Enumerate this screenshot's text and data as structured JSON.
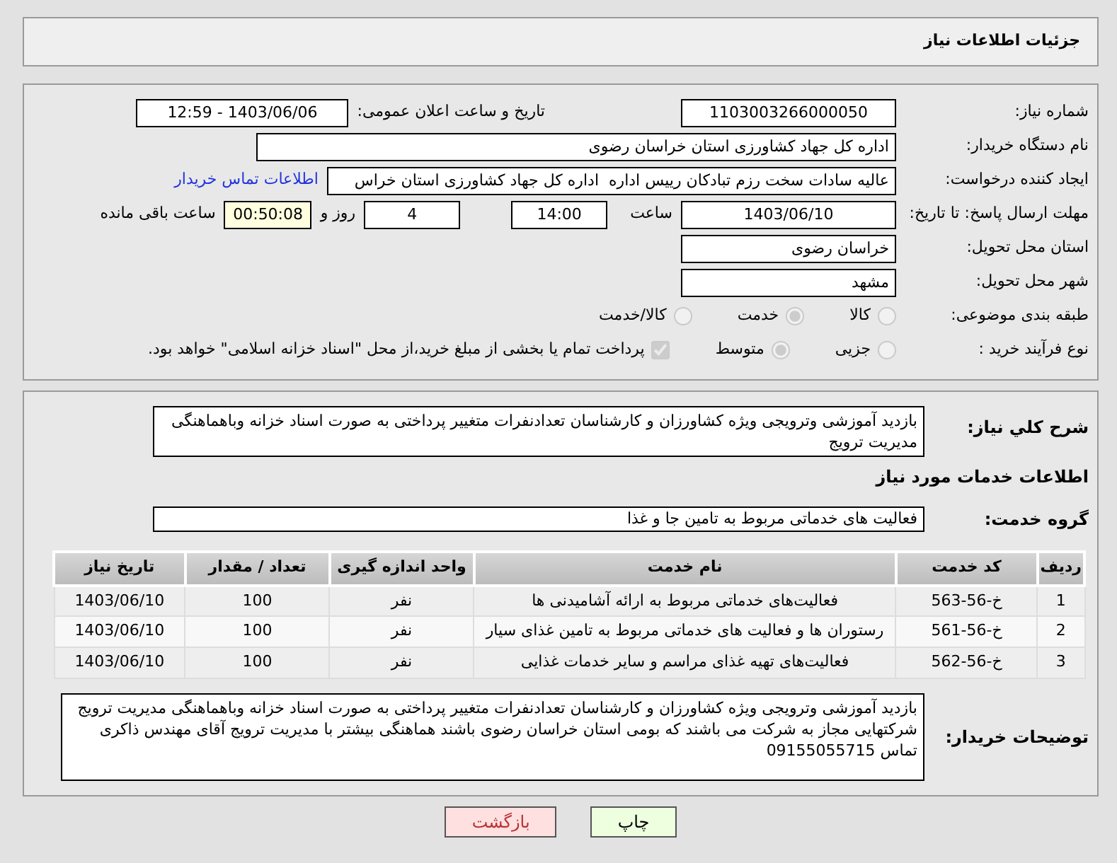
{
  "header": {
    "title": "جزئیات اطلاعات نیاز"
  },
  "need_number": {
    "label": "شماره نیاز:",
    "value": "1103003266000050"
  },
  "announce": {
    "label": "تاریخ و ساعت اعلان عمومی:",
    "value": "1403/06/06 - 12:59"
  },
  "buyer_org": {
    "label": "نام دستگاه خریدار:",
    "value": "اداره کل جهاد کشاورزی استان خراسان رضوی"
  },
  "requester": {
    "label": "ایجاد کننده درخواست:",
    "value": "عالیه سادات سخت رزم تبادکان رییس اداره  اداره کل جهاد کشاورزی استان خراس",
    "link": "اطلاعات تماس خریدار"
  },
  "deadline": {
    "label": "مهلت ارسال پاسخ: تا تاریخ:",
    "date": "1403/06/10",
    "time_label": "ساعت",
    "time": "14:00",
    "days": "4",
    "days_label": "روز و",
    "remaining": "00:50:08",
    "remaining_label": "ساعت باقی مانده"
  },
  "province": {
    "label": "استان محل تحویل:",
    "value": "خراسان رضوی"
  },
  "city": {
    "label": "شهر محل تحویل:",
    "value": "مشهد"
  },
  "category": {
    "label": "طبقه بندی موضوعی:",
    "options": [
      {
        "label": "کالا",
        "selected": false
      },
      {
        "label": "خدمت",
        "selected": true
      },
      {
        "label": "کالا/خدمت",
        "selected": false
      }
    ]
  },
  "process": {
    "label": "نوع فرآیند خرید :",
    "options": [
      {
        "label": "جزیی",
        "selected": false
      },
      {
        "label": "متوسط",
        "selected": true
      }
    ],
    "payment": {
      "label": "پرداخت تمام یا بخشی از مبلغ خرید،از محل \"اسناد خزانه اسلامی\" خواهد بود.",
      "checked": true
    }
  },
  "description": {
    "label": "شرح کلي نياز:",
    "value": "بازدید آموزشی وترویجی ویژه کشاورزان و کارشناسان تعدادنفرات متغییر پرداختی به صورت اسناد خزانه وباهماهنگی مدیریت ترویج"
  },
  "services_title": "اطلاعات خدمات مورد نیاز",
  "service_group": {
    "label": "گروه خدمت:",
    "value": "فعالیت های خدماتی مربوط به تامین جا و غذا"
  },
  "table": {
    "columns": [
      "ردیف",
      "کد خدمت",
      "نام خدمت",
      "واحد اندازه گیری",
      "تعداد / مقدار",
      "تاریخ نیاز"
    ],
    "rows": [
      [
        "1",
        "خ-56-563",
        "فعالیت‌های خدماتی مربوط به ارائه آشامیدنی ها",
        "نفر",
        "100",
        "1403/06/10"
      ],
      [
        "2",
        "خ-56-561",
        "رستوران ها و فعالیت های خدماتی مربوط به تامین غذای سیار",
        "نفر",
        "100",
        "1403/06/10"
      ],
      [
        "3",
        "خ-56-562",
        "فعالیت‌های تهیه غذای مراسم و سایر خدمات غذایی",
        "نفر",
        "100",
        "1403/06/10"
      ]
    ]
  },
  "buyer_notes": {
    "label": "توضیحات خریدار:",
    "value": "بازدید آموزشی وترویجی ویژه کشاورزان و کارشناسان تعدادنفرات متغییر پرداختی به صورت اسناد خزانه وباهماهنگی مدیریت ترویج شرکتهایی مجاز به شرکت می باشند که بومی استان خراسان رضوی باشند هماهنگی بیشتر با مدیریت ترویج آقای مهندس ذاکری تماس 09155055715"
  },
  "buttons": [
    {
      "label": "چاپ",
      "kind": "print"
    },
    {
      "label": "بازگشت",
      "kind": "back"
    }
  ]
}
